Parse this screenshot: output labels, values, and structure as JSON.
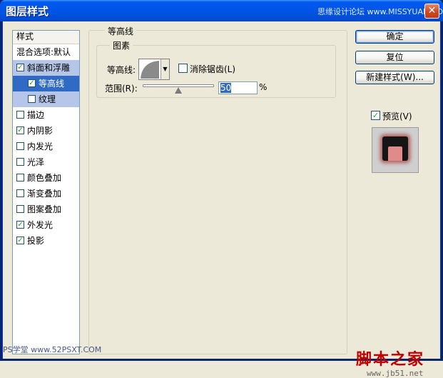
{
  "window": {
    "title": "图层样式",
    "top_watermark": "思缘设计论坛 www.MISSYUAN.COM",
    "close_glyph": "✕"
  },
  "styles_list": {
    "header": "样式",
    "blend_options": "混合选项:默认",
    "items": [
      {
        "label": "斜面和浮雕",
        "checked": true
      },
      {
        "label": "等高线",
        "checked": true
      },
      {
        "label": "纹理",
        "checked": false
      },
      {
        "label": "描边",
        "checked": false
      },
      {
        "label": "内阴影",
        "checked": true
      },
      {
        "label": "内发光",
        "checked": false
      },
      {
        "label": "光泽",
        "checked": false
      },
      {
        "label": "颜色叠加",
        "checked": false
      },
      {
        "label": "渐变叠加",
        "checked": false
      },
      {
        "label": "图案叠加",
        "checked": false
      },
      {
        "label": "外发光",
        "checked": true
      },
      {
        "label": "投影",
        "checked": true
      }
    ]
  },
  "contour_panel": {
    "title": "等高线",
    "group": "图素",
    "contour_label": "等高线:",
    "anti_alias_label": "消除锯齿(L)",
    "range_label": "范围(R):",
    "range_value": "50",
    "range_unit": "%",
    "range_fraction": 0.5
  },
  "buttons": {
    "ok": "确定",
    "reset": "复位",
    "new_style": "新建样式(W)..."
  },
  "preview": {
    "label": "预览(V)",
    "checked": true
  },
  "bottom_watermarks": {
    "left": "PS学堂 www.52PSXT.COM",
    "right": "脚本之家",
    "url": "www.jb51.net"
  },
  "colors": {
    "titlebar": "#0055e5",
    "selection": "#316ac5",
    "highlight": "#b6c6e8",
    "check": "#21a121"
  }
}
